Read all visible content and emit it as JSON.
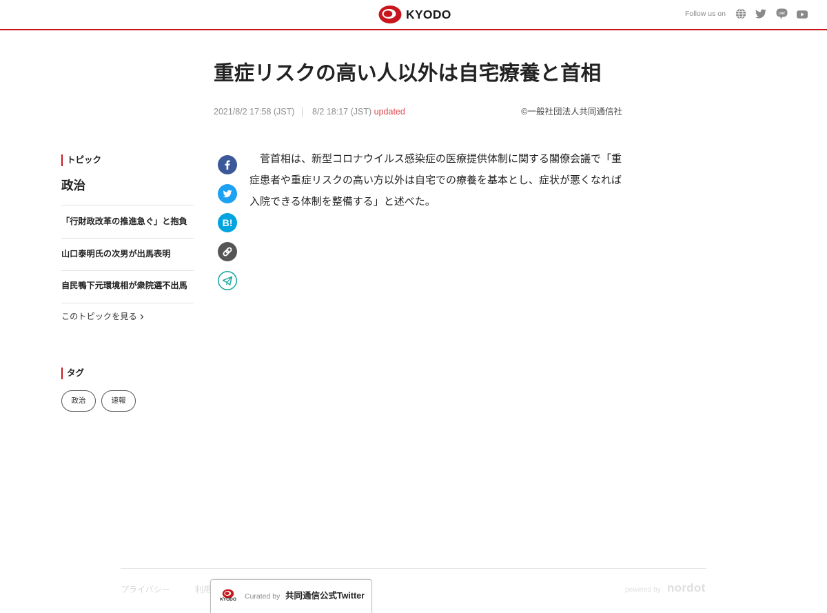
{
  "header": {
    "logo_text": "KYODO",
    "follow_label": "Follow us on",
    "social_icons": [
      "globe-icon",
      "twitter-icon",
      "line-icon",
      "youtube-icon"
    ],
    "line_icon_label": "LINE"
  },
  "article": {
    "title": "重症リスクの高い人以外は自宅療養と首相",
    "published": "2021/8/2 17:58 (JST)",
    "updated_time": "8/2 18:17 (JST)",
    "updated_label": "updated",
    "copyright": "©一般社団法人共同通信社",
    "body": "　菅首相は、新型コロナウイルス感染症の医療提供体制に関する閣僚会議で「重症患者や重症リスクの高い方以外は自宅での療養を基本とし、症状が悪くなれば入院できる体制を整備する」と述べた。"
  },
  "share": {
    "icons": [
      "facebook-icon",
      "twitter-icon",
      "hatena-bookmark-icon",
      "link-icon",
      "telegram-icon"
    ],
    "hatena_label": "B!"
  },
  "sidebar": {
    "topic_heading": "トピック",
    "topic_name": "政治",
    "topic_items": [
      "「行財政改革の推進急ぐ」と抱負",
      "山口泰明氏の次男が出馬表明",
      "自民鴨下元環境相が衆院選不出馬"
    ],
    "topic_more": "このトピックを見る",
    "topic_more_icon": "chevron-right-icon",
    "tag_heading": "タグ",
    "tags": [
      "政治",
      "速報"
    ]
  },
  "footer": {
    "links": [
      "プライバシー",
      "利用"
    ],
    "powered_by": "powered by",
    "brand": "nordot"
  },
  "curator": {
    "logo_text": "KYODO",
    "curated_by": "Curated by",
    "name": "共同通信公式Twitter"
  },
  "colors": {
    "brand_red": "#c8161d",
    "updated_red": "#e0474c",
    "icon_gray": "#8a8a8a",
    "facebook_blue": "#3b5998",
    "twitter_blue": "#1da1f2",
    "hatena_blue": "#00a4de",
    "link_gray": "#555555",
    "telegram_teal": "#22a9a4"
  }
}
